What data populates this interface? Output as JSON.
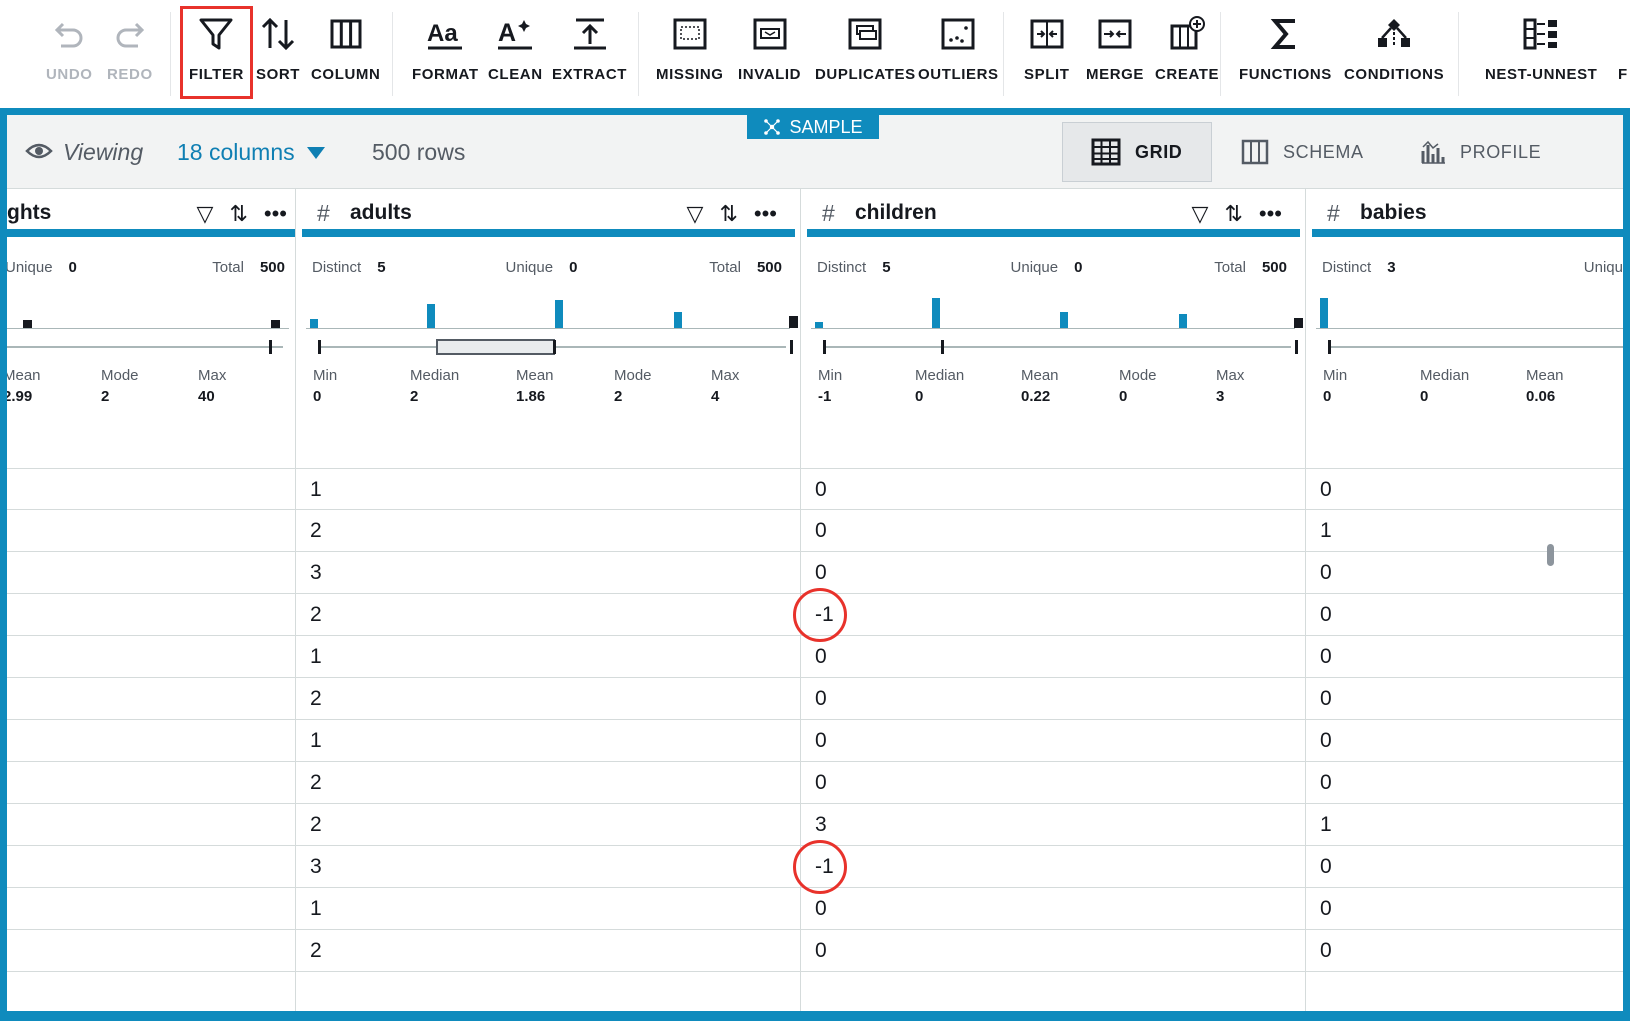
{
  "toolbar": {
    "undo": "UNDO",
    "redo": "REDO",
    "filter": "FILTER",
    "sort": "SORT",
    "column": "COLUMN",
    "format": "FORMAT",
    "clean": "CLEAN",
    "extract": "EXTRACT",
    "missing": "MISSING",
    "invalid": "INVALID",
    "duplicates": "DUPLICATES",
    "outliers": "OUTLIERS",
    "split": "SPLIT",
    "merge": "MERGE",
    "create": "CREATE",
    "functions": "FUNCTIONS",
    "conditions": "CONDITIONS",
    "nest_unnest": "NEST-UNNEST",
    "trailing": "F"
  },
  "viewbar": {
    "sample": "SAMPLE",
    "viewing": "Viewing",
    "columns": "18 columns",
    "rows": "500 rows",
    "tabs": {
      "grid": "GRID",
      "schema": "SCHEMA",
      "profile": "PROFILE"
    }
  },
  "columns": [
    {
      "name": "ghts",
      "stats": {
        "unique_label": "Unique",
        "unique": "0",
        "total_label": "Total",
        "total": "500"
      },
      "summary": [
        {
          "label": "Mean",
          "value": "2.99"
        },
        {
          "label": "Mode",
          "value": "2"
        },
        {
          "label": "Max",
          "value": "40"
        }
      ],
      "cells": [
        "",
        "",
        "",
        "",
        "",
        "",
        "",
        "",
        "",
        "",
        "",
        ""
      ]
    },
    {
      "name": "adults",
      "stats": {
        "distinct_label": "Distinct",
        "distinct": "5",
        "unique_label": "Unique",
        "unique": "0",
        "total_label": "Total",
        "total": "500"
      },
      "summary": [
        {
          "label": "Min",
          "value": "0"
        },
        {
          "label": "Median",
          "value": "2"
        },
        {
          "label": "Mean",
          "value": "1.86"
        },
        {
          "label": "Mode",
          "value": "2"
        },
        {
          "label": "Max",
          "value": "4"
        }
      ],
      "cells": [
        "1",
        "2",
        "3",
        "2",
        "1",
        "2",
        "1",
        "2",
        "2",
        "3",
        "1",
        "2"
      ]
    },
    {
      "name": "children",
      "stats": {
        "distinct_label": "Distinct",
        "distinct": "5",
        "unique_label": "Unique",
        "unique": "0",
        "total_label": "Total",
        "total": "500"
      },
      "summary": [
        {
          "label": "Min",
          "value": "-1"
        },
        {
          "label": "Median",
          "value": "0"
        },
        {
          "label": "Mean",
          "value": "0.22"
        },
        {
          "label": "Mode",
          "value": "0"
        },
        {
          "label": "Max",
          "value": "3"
        }
      ],
      "cells": [
        "0",
        "0",
        "0",
        "-1",
        "0",
        "0",
        "0",
        "0",
        "3",
        "-1",
        "0",
        "0"
      ]
    },
    {
      "name": "babies",
      "stats": {
        "distinct_label": "Distinct",
        "distinct": "3",
        "unique_label": "Uniqu"
      },
      "summary": [
        {
          "label": "Min",
          "value": "0"
        },
        {
          "label": "Median",
          "value": "0"
        },
        {
          "label": "Mean",
          "value": "0.06"
        }
      ],
      "cells": [
        "0",
        "1",
        "0",
        "0",
        "0",
        "0",
        "0",
        "0",
        "1",
        "0",
        "0",
        "0"
      ]
    }
  ],
  "colors": {
    "accent": "#0f8bbd",
    "highlight": "#e8322b"
  }
}
